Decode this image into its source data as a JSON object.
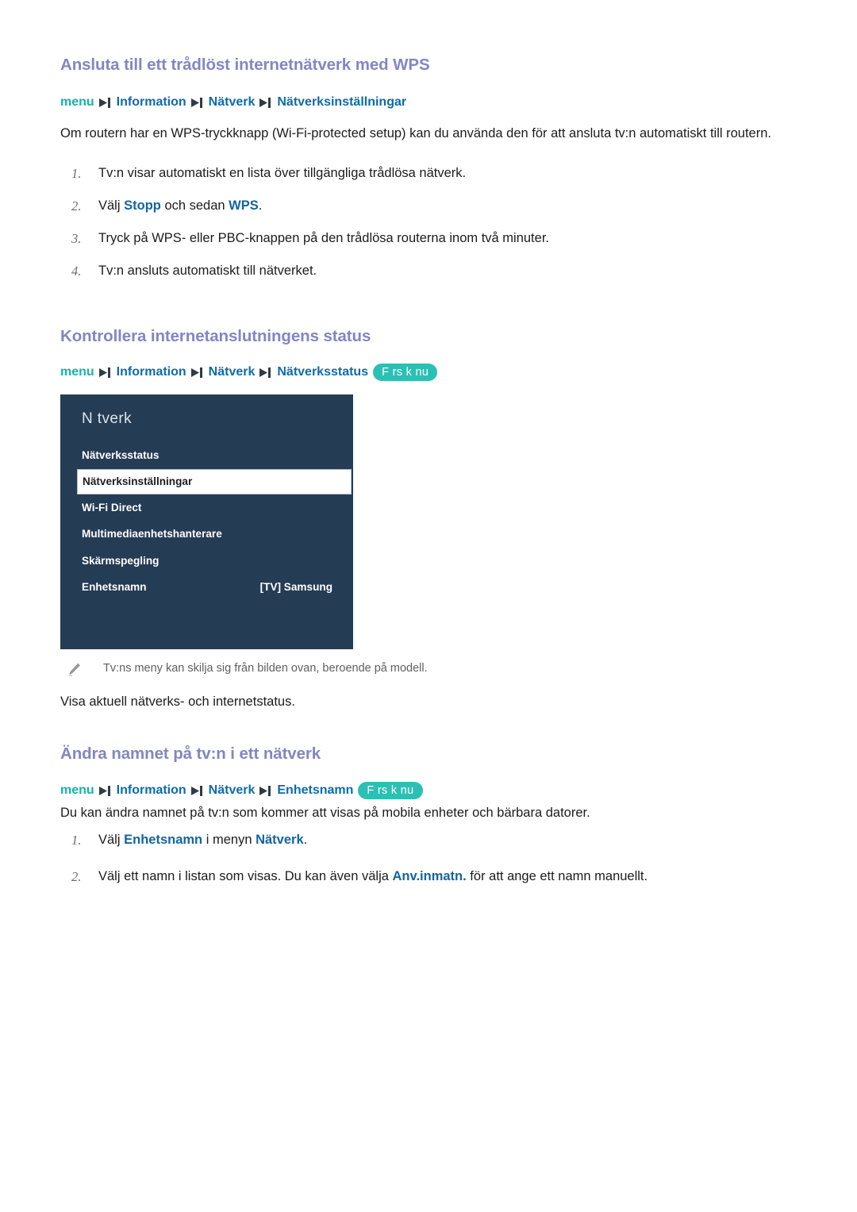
{
  "sections": [
    {
      "title": "Ansluta till ett trådlöst internetnätverk med WPS",
      "breadcrumb": {
        "menu": "menu",
        "crumbs": [
          "Information",
          "Nätverk",
          "Nätverksinställningar"
        ],
        "pill": null
      },
      "intro": "Om routern har en WPS-tryckknapp (Wi-Fi-protected setup) kan du använda den för att ansluta tv:n automatiskt till routern.",
      "steps": [
        {
          "num": "1.",
          "parts": [
            {
              "t": "Tv:n visar automatiskt en lista över tillgängliga trådlösa nätverk.",
              "b": false
            }
          ]
        },
        {
          "num": "2.",
          "parts": [
            {
              "t": "Välj ",
              "b": false
            },
            {
              "t": "Stopp",
              "b": true
            },
            {
              "t": " och sedan ",
              "b": false
            },
            {
              "t": "WPS",
              "b": true
            },
            {
              "t": ".",
              "b": false
            }
          ]
        },
        {
          "num": "3.",
          "parts": [
            {
              "t": "Tryck på WPS- eller PBC-knappen på den trådlösa routerna inom två minuter.",
              "b": false
            }
          ]
        },
        {
          "num": "4.",
          "parts": [
            {
              "t": "Tv:n ansluts automatiskt till nätverket.",
              "b": false
            }
          ]
        }
      ]
    },
    {
      "title": "Kontrollera internetanslutningens status",
      "breadcrumb": {
        "menu": "menu",
        "crumbs": [
          "Information",
          "Nätverk",
          "Nätverksstatus"
        ],
        "pill": "F rs k nu"
      },
      "note": "Tv:ns meny kan skilja sig från bilden ovan, beroende på modell.",
      "outro": "Visa aktuell nätverks- och internetstatus."
    },
    {
      "title": "Ändra namnet på tv:n i ett nätverk",
      "breadcrumb": {
        "menu": "menu",
        "crumbs": [
          "Information",
          "Nätverk",
          "Enhetsnamn"
        ],
        "pill": "F rs k nu"
      },
      "intro": "Du kan ändra namnet på tv:n som kommer att visas på mobila enheter och bärbara datorer.",
      "steps": [
        {
          "num": "1.",
          "parts": [
            {
              "t": "Välj ",
              "b": false
            },
            {
              "t": "Enhetsnamn",
              "b": true
            },
            {
              "t": " i menyn ",
              "b": false
            },
            {
              "t": "Nätverk",
              "b": true
            },
            {
              "t": ".",
              "b": false
            }
          ]
        },
        {
          "num": "2.",
          "parts": [
            {
              "t": "Välj ett namn i listan som visas. Du kan även välja ",
              "b": false
            },
            {
              "t": "Anv.inmatn.",
              "b": true
            },
            {
              "t": " för att ange ett namn manuellt.",
              "b": false
            }
          ]
        }
      ]
    }
  ],
  "tv_menu": {
    "title": "N tverk",
    "rows": [
      {
        "label": "Nätverksstatus",
        "value": "",
        "selected": false
      },
      {
        "label": "Nätverksinställningar",
        "value": "",
        "selected": true
      },
      {
        "label": "Wi-Fi Direct",
        "value": "",
        "selected": false
      },
      {
        "label": "Multimediaenhetshanterare",
        "value": "",
        "selected": false
      },
      {
        "label": "Skärmspegling",
        "value": "",
        "selected": false
      },
      {
        "label": "Enhetsnamn",
        "value": "[TV] Samsung",
        "selected": false
      }
    ]
  },
  "colors": {
    "heading": "#8186c4",
    "crumb_menu": "#18b3a7",
    "crumb_link": "#0e6ba8",
    "pill_bg": "#2cc0b4",
    "bold_blue": "#1464a0",
    "tv_bg": "#253c55"
  }
}
